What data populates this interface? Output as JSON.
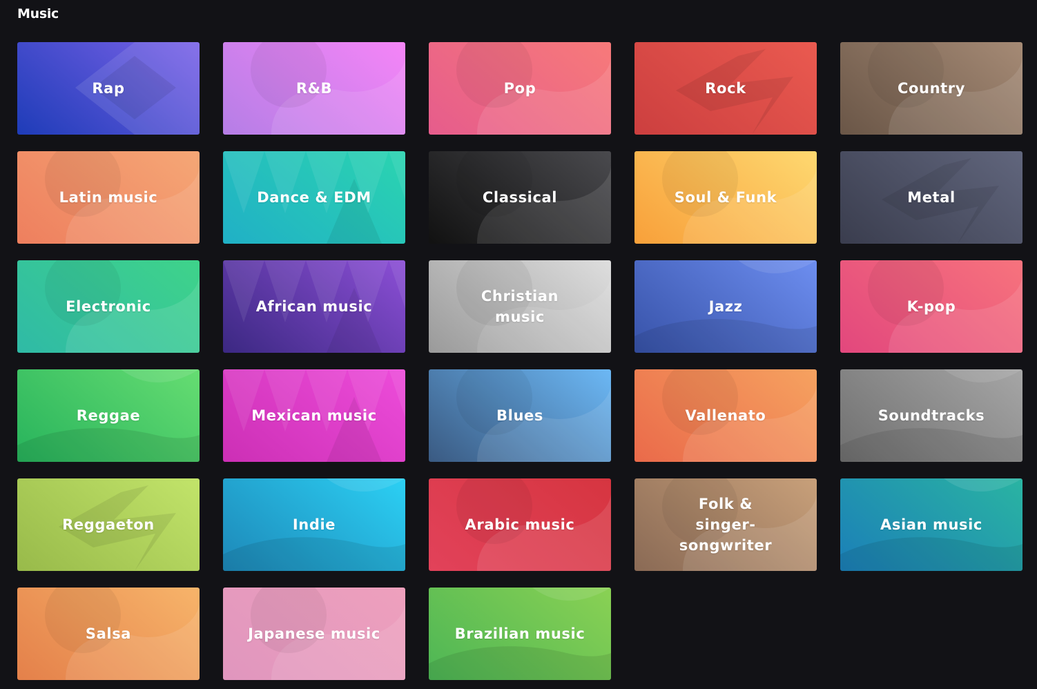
{
  "section": {
    "title": "Music"
  },
  "genres": [
    {
      "label": "Rap",
      "c1": "#1e3cb8",
      "c2": "#7a62e8",
      "shape": "diamond"
    },
    {
      "label": "R&B",
      "c1": "#b57ee6",
      "c2": "#f585f7",
      "shape": "blob"
    },
    {
      "label": "Pop",
      "c1": "#e65c8c",
      "c2": "#f77a7a",
      "shape": "blob"
    },
    {
      "label": "Rock",
      "c1": "#cc3f3f",
      "c2": "#ea5a50",
      "shape": "zigzag"
    },
    {
      "label": "Country",
      "c1": "#6a5647",
      "c2": "#a58a75",
      "shape": "blob"
    },
    {
      "label": "Latin music",
      "c1": "#ee7f5e",
      "c2": "#f5a776",
      "shape": "blob"
    },
    {
      "label": "Dance & EDM",
      "c1": "#20b0c6",
      "c2": "#2bd4b0",
      "shape": "peaks"
    },
    {
      "label": "Classical",
      "c1": "#111111",
      "c2": "#4a4a4e",
      "shape": "blob"
    },
    {
      "label": "Soul & Funk",
      "c1": "#f8a03a",
      "c2": "#fed870",
      "shape": "blob"
    },
    {
      "label": "Metal",
      "c1": "#3a3d4e",
      "c2": "#61667d",
      "shape": "zigzag"
    },
    {
      "label": "Electronic",
      "c1": "#2fbaa6",
      "c2": "#3fd38a",
      "shape": "blob"
    },
    {
      "label": "African music",
      "c1": "#3b2882",
      "c2": "#8c4fd6",
      "shape": "peaks"
    },
    {
      "label": "Christian music",
      "c1": "#9a9a9a",
      "c2": "#dedede",
      "shape": "blob"
    },
    {
      "label": "Jazz",
      "c1": "#3752a8",
      "c2": "#6d8ef0",
      "shape": "wave"
    },
    {
      "label": "K-pop",
      "c1": "#e2477d",
      "c2": "#f7737d",
      "shape": "blob"
    },
    {
      "label": "Reggae",
      "c1": "#27b35c",
      "c2": "#66dd72",
      "shape": "wave"
    },
    {
      "label": "Mexican music",
      "c1": "#cc2fb5",
      "c2": "#ed4cda",
      "shape": "peaks"
    },
    {
      "label": "Blues",
      "c1": "#3a5a82",
      "c2": "#6cb8f5",
      "shape": "blob"
    },
    {
      "label": "Vallenato",
      "c1": "#ea6a4a",
      "c2": "#f6a260",
      "shape": "blob"
    },
    {
      "label": "Soundtracks",
      "c1": "#6f6f6f",
      "c2": "#a6a6a6",
      "shape": "wave"
    },
    {
      "label": "Reggaeton",
      "c1": "#98ba4a",
      "c2": "#c2e46a",
      "shape": "zigzag"
    },
    {
      "label": "Indie",
      "c1": "#1d88b8",
      "c2": "#2cd0f4",
      "shape": "wave"
    },
    {
      "label": "Arabic music",
      "c1": "#e2425a",
      "c2": "#d63540",
      "shape": "blob"
    },
    {
      "label": "Folk & singer-songwriter",
      "c1": "#8a6a55",
      "c2": "#c8a07a",
      "shape": "blob"
    },
    {
      "label": "Asian music",
      "c1": "#1b7fb8",
      "c2": "#2ab4a2",
      "shape": "wave"
    },
    {
      "label": "Salsa",
      "c1": "#e4804a",
      "c2": "#f7b46a",
      "shape": "blob"
    },
    {
      "label": "Japanese music",
      "c1": "#e096be",
      "c2": "#eea0bd",
      "shape": "blob"
    },
    {
      "label": "Brazilian music",
      "c1": "#4db655",
      "c2": "#8ad154",
      "shape": "wave"
    }
  ]
}
